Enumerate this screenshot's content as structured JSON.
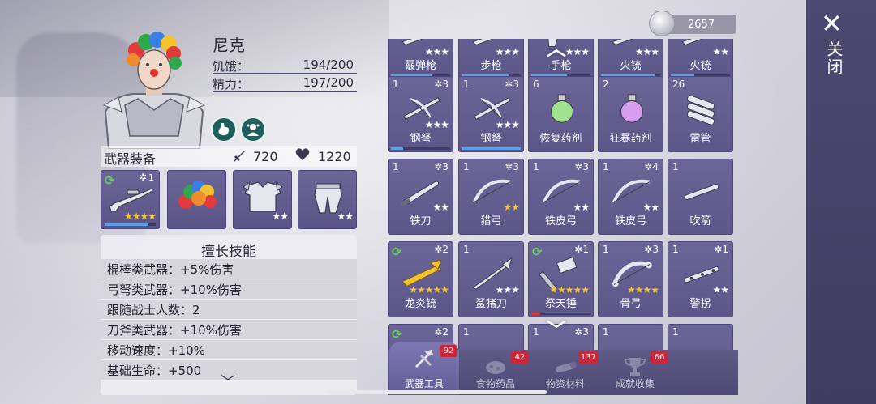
{
  "currency": {
    "coins": "2657",
    "icon": "silver-coin-icon"
  },
  "character": {
    "name": "尼克",
    "hunger_label": "饥饿：",
    "hunger_value": "194/200",
    "energy_label": "精力：",
    "energy_value": "197/200",
    "status_icons": [
      "stomach-icon",
      "companion-icon"
    ]
  },
  "equipment": {
    "title": "武器装备",
    "attack": "720",
    "health": "1220",
    "slots": [
      {
        "item": "sniper-rifle",
        "level": "1",
        "stars": 4,
        "star_color": "gold",
        "cycle": true,
        "bar": 0.85
      },
      {
        "item": "clown-wig",
        "level": "",
        "stars": 0,
        "star_color": "white",
        "cycle": false,
        "bar": 0
      },
      {
        "item": "armor-vest",
        "level": "",
        "stars": 2,
        "star_color": "white",
        "cycle": false,
        "bar": 0
      },
      {
        "item": "armor-pants",
        "level": "",
        "stars": 2,
        "star_color": "white",
        "cycle": false,
        "bar": 0
      }
    ]
  },
  "skills": {
    "title": "擅长技能",
    "items": [
      "棍棒类武器：+5%伤害",
      "弓弩类武器：+10%伤害",
      "跟随战士人数：2",
      "刀斧类武器：+10%伤害",
      "移动速度：+10%",
      "基础生命：+500"
    ]
  },
  "inventory": {
    "rows": [
      [
        {
          "count": "",
          "level": "",
          "name": "霰弹枪",
          "stars": 3,
          "star_color": "white",
          "cycle": false,
          "icon": "shotgun",
          "bar": 0.7
        },
        {
          "count": "",
          "level": "",
          "name": "步枪",
          "stars": 3,
          "star_color": "white",
          "cycle": false,
          "icon": "rifle",
          "bar": 0.8
        },
        {
          "count": "",
          "level": "",
          "name": "手枪",
          "stars": 3,
          "star_color": "white",
          "cycle": false,
          "icon": "pistol",
          "bar": 0.6
        },
        {
          "count": "",
          "level": "",
          "name": "火铳",
          "stars": 3,
          "star_color": "white",
          "cycle": false,
          "icon": "musket",
          "bar": 0.9
        },
        {
          "count": "",
          "level": "",
          "name": "火铳",
          "stars": 2,
          "star_color": "white",
          "cycle": false,
          "icon": "musket",
          "bar": 0.4
        }
      ],
      [
        {
          "count": "1",
          "level": "3",
          "name": "钢弩",
          "stars": 3,
          "star_color": "white",
          "cycle": false,
          "icon": "crossbow",
          "bar": 0.2
        },
        {
          "count": "1",
          "level": "3",
          "name": "钢弩",
          "stars": 3,
          "star_color": "white",
          "cycle": false,
          "icon": "crossbow",
          "bar": 1.0
        },
        {
          "count": "6",
          "level": "",
          "name": "恢复药剂",
          "stars": 0,
          "star_color": "white",
          "cycle": false,
          "icon": "potion-green",
          "bar": 0
        },
        {
          "count": "2",
          "level": "",
          "name": "狂暴药剂",
          "stars": 0,
          "star_color": "white",
          "cycle": false,
          "icon": "potion-purple",
          "bar": 0
        },
        {
          "count": "26",
          "level": "",
          "name": "雷管",
          "stars": 0,
          "star_color": "white",
          "cycle": false,
          "icon": "dynamite",
          "bar": 0
        }
      ],
      [
        {
          "count": "1",
          "level": "3",
          "name": "铁刀",
          "stars": 2,
          "star_color": "white",
          "cycle": false,
          "icon": "knife",
          "bar": 0
        },
        {
          "count": "1",
          "level": "3",
          "name": "猎弓",
          "stars": 2,
          "star_color": "gold",
          "cycle": false,
          "icon": "bow",
          "bar": 0
        },
        {
          "count": "1",
          "level": "3",
          "name": "铁皮弓",
          "stars": 2,
          "star_color": "white",
          "cycle": false,
          "icon": "bow",
          "bar": 0
        },
        {
          "count": "1",
          "level": "4",
          "name": "铁皮弓",
          "stars": 2,
          "star_color": "white",
          "cycle": false,
          "icon": "bow",
          "bar": 0
        },
        {
          "count": "1",
          "level": "",
          "name": "吹箭",
          "stars": 0,
          "star_color": "white",
          "cycle": false,
          "icon": "blowpipe",
          "bar": 0
        }
      ],
      [
        {
          "count": "",
          "level": "2",
          "name": "龙炎铳",
          "stars": 5,
          "star_color": "gold",
          "cycle": true,
          "icon": "dragon-gun",
          "bar": 0
        },
        {
          "count": "1",
          "level": "",
          "name": "鲨猪刀",
          "stars": 3,
          "star_color": "white",
          "cycle": false,
          "icon": "spear",
          "bar": 0
        },
        {
          "count": "",
          "level": "1",
          "name": "祭天锤",
          "stars": 5,
          "star_color": "gold",
          "cycle": true,
          "icon": "hammer",
          "bar": 0.15
        },
        {
          "count": "1",
          "level": "3",
          "name": "骨弓",
          "stars": 4,
          "star_color": "gold",
          "cycle": false,
          "icon": "bone-bow",
          "bar": 0
        },
        {
          "count": "1",
          "level": "1",
          "name": "警拐",
          "stars": 2,
          "star_color": "white",
          "cycle": false,
          "icon": "baton",
          "bar": 0
        }
      ],
      [
        {
          "count": "",
          "level": "2",
          "name": "",
          "stars": 0,
          "star_color": "white",
          "cycle": true,
          "icon": "",
          "bar": 0
        },
        {
          "count": "1",
          "level": "",
          "name": "",
          "stars": 0,
          "star_color": "white",
          "cycle": false,
          "icon": "",
          "bar": 0
        },
        {
          "count": "1",
          "level": "3",
          "name": "",
          "stars": 0,
          "star_color": "white",
          "cycle": false,
          "icon": "",
          "bar": 0
        },
        {
          "count": "1",
          "level": "",
          "name": "",
          "stars": 0,
          "star_color": "white",
          "cycle": false,
          "icon": "",
          "bar": 0
        },
        {
          "count": "1",
          "level": "",
          "name": "",
          "stars": 0,
          "star_color": "white",
          "cycle": false,
          "icon": "",
          "bar": 0
        }
      ]
    ]
  },
  "tabs": [
    {
      "label": "武器工具",
      "badge": "92",
      "active": true,
      "icon": "tools-icon"
    },
    {
      "label": "食物药品",
      "badge": "42",
      "active": false,
      "icon": "food-icon"
    },
    {
      "label": "物资材料",
      "badge": "137",
      "active": false,
      "icon": "materials-icon"
    },
    {
      "label": "成就收集",
      "badge": "66",
      "active": false,
      "icon": "trophy-icon"
    }
  ],
  "close_panel": {
    "label": "关闭"
  }
}
